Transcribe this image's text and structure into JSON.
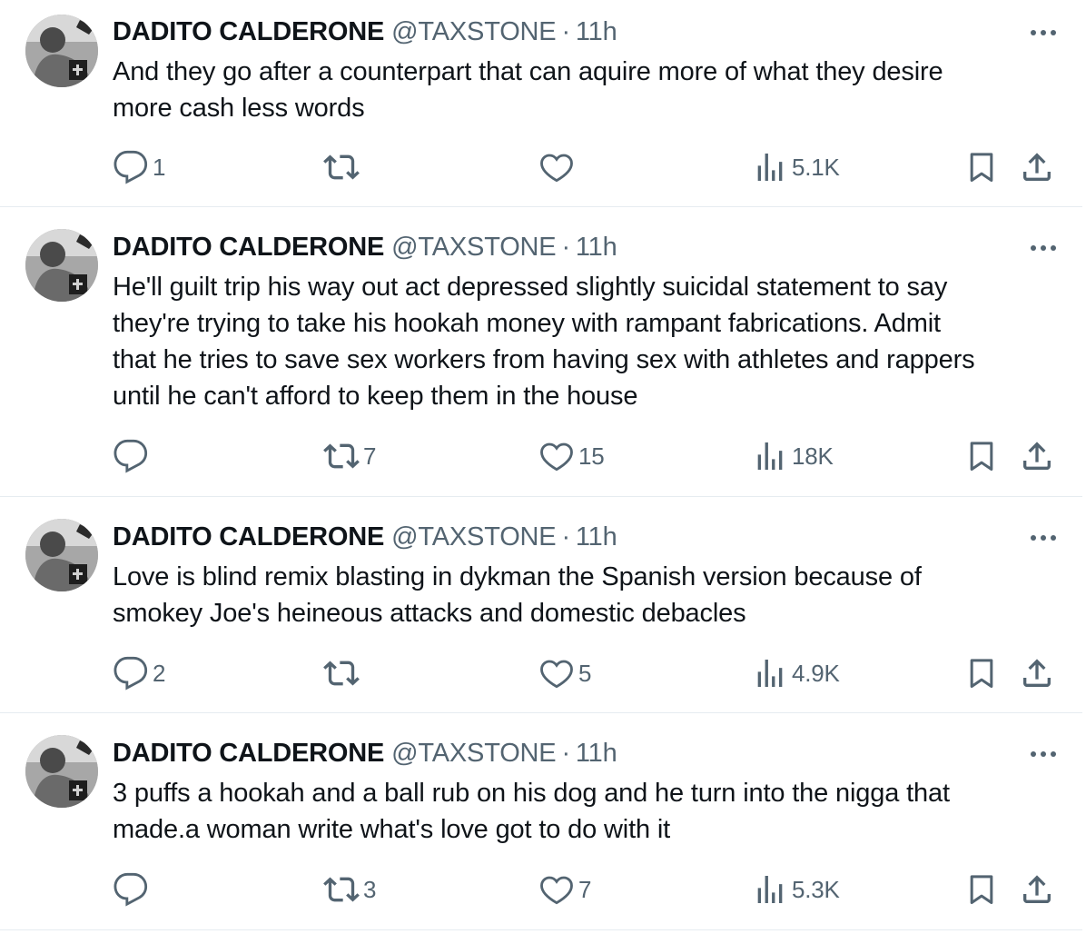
{
  "tweets": [
    {
      "name": "DADITO CALDERONE",
      "handle": "@TAXSTONE",
      "separator": "·",
      "time": "11h",
      "lines": [
        "And they go after a counterpart that can aquire more of what they desire",
        "more cash less words"
      ],
      "replies": "1",
      "retweets": "",
      "likes": "",
      "views": "5.1K"
    },
    {
      "name": "DADITO CALDERONE",
      "handle": "@TAXSTONE",
      "separator": "·",
      "time": "11h",
      "lines": [
        "He'll guilt trip his way out act depressed slightly suicidal statement to say",
        "they're trying to take his hookah money with rampant fabrications. Admit",
        "that he tries to save sex workers from having sex with athletes and rappers",
        "until he can't afford to keep them in the house"
      ],
      "replies": "",
      "retweets": "7",
      "likes": "15",
      "views": "18K"
    },
    {
      "name": "DADITO CALDERONE",
      "handle": "@TAXSTONE",
      "separator": "·",
      "time": "11h",
      "lines": [
        "Love is blind remix blasting in dykman the Spanish version because of",
        "smokey Joe's heineous attacks and domestic debacles"
      ],
      "replies": "2",
      "retweets": "",
      "likes": "5",
      "views": "4.9K"
    },
    {
      "name": "DADITO CALDERONE",
      "handle": "@TAXSTONE",
      "separator": "·",
      "time": "11h",
      "lines": [
        "3 puffs a hookah and a ball rub on his dog and he turn into the nigga that",
        "made.a woman write what's love got to do with it"
      ],
      "replies": "",
      "retweets": "3",
      "likes": "7",
      "views": "5.3K"
    }
  ],
  "icons": {
    "more": "more-horizontal-icon",
    "reply": "reply-icon",
    "retweet": "retweet-icon",
    "like": "heart-icon",
    "views": "views-icon",
    "bookmark": "bookmark-icon",
    "share": "share-icon"
  },
  "colors": {
    "text": "#0f1419",
    "secondary": "#536471",
    "divider": "#e6ecf0",
    "background": "#ffffff"
  }
}
